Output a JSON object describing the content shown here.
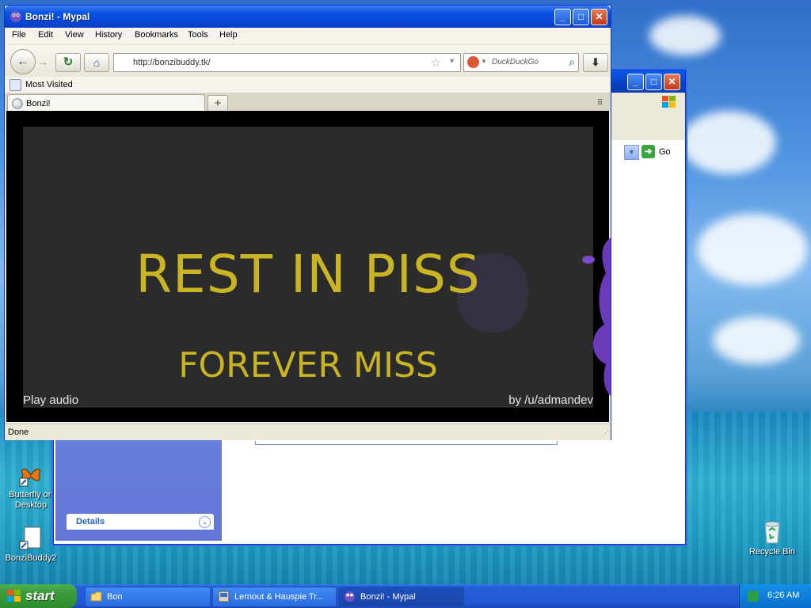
{
  "desktop": {
    "icons": [
      {
        "label": "Butterfly on Desktop"
      },
      {
        "label": "BonziBuddy2"
      },
      {
        "label": "Recycle Bin"
      }
    ]
  },
  "explorer": {
    "go_label": "Go",
    "details_label": "Details"
  },
  "browser": {
    "window_title": "Bonzi! - Mypal",
    "menus": [
      "File",
      "Edit",
      "View",
      "History",
      "Bookmarks",
      "Tools",
      "Help"
    ],
    "url": "http://bonzibuddy.tk/",
    "search_placeholder": "DuckDuckGo",
    "bookmarks_label": "Most Visited",
    "tab_title": "Bonzi!",
    "status": "Done",
    "page": {
      "headline": "REST IN PISS",
      "subline": "FOREVER MISS",
      "play_audio": "Play audio",
      "credit": "by /u/admandev"
    }
  },
  "taskbar": {
    "start_label": "start",
    "tasks": [
      {
        "label": "Bon"
      },
      {
        "label": "Lernout & Hauspie Tr..."
      },
      {
        "label": "Bonzi! - Mypal"
      }
    ],
    "clock": "6:26 AM"
  },
  "colors": {
    "headline": "#c9b425",
    "slide_background": "#2b2b2b",
    "titlebar": "#0846d6"
  }
}
